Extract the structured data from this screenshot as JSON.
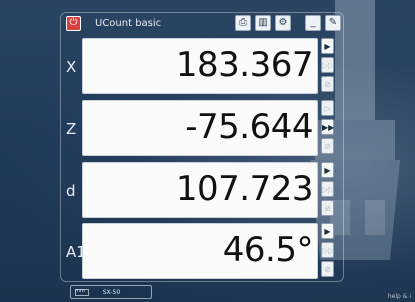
{
  "app": {
    "title": "UCount basic"
  },
  "toolbar": {
    "icons": [
      "print-icon",
      "chart-icon",
      "gear-icon",
      "minimize-icon",
      "edit-icon"
    ]
  },
  "axes": [
    {
      "label": "X",
      "value": "183.367",
      "btn_top": "▶",
      "btn_mid": "▷▷",
      "btn_bot": "⊘"
    },
    {
      "label": "Z",
      "value": "-75.644",
      "btn_top": "▷",
      "btn_mid": "▶▶",
      "btn_bot": "⊘"
    },
    {
      "label": "d",
      "value": "107.723",
      "btn_top": "▶",
      "btn_mid": "▷▷",
      "btn_bot": "⊘"
    },
    {
      "label": "A1",
      "value": "46.5°",
      "btn_top": "▶",
      "btn_mid": "▷▷",
      "btn_bot": "⊘"
    }
  ],
  "status": {
    "model": "SX-50",
    "mini_label": "mm"
  },
  "help_text": "help & i"
}
